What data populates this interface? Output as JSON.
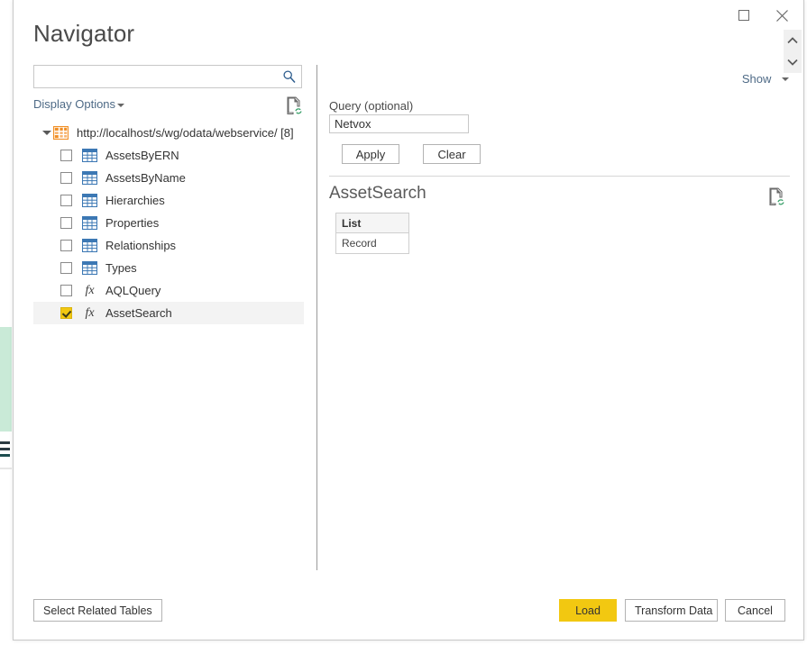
{
  "window": {
    "title": "Navigator",
    "maximize_icon": "maximize-icon",
    "close_icon": "close-icon"
  },
  "left_pane": {
    "search": {
      "value": "",
      "placeholder": "",
      "icon": "search-icon"
    },
    "display_options": {
      "label": "Display Options",
      "caret_icon": "chevron-down-icon"
    },
    "refresh_icon": "refresh-document-icon",
    "tree": {
      "root": {
        "label": "http://localhost/s/wg/odata/webservice/ [8]",
        "icon": "database-icon",
        "expander_icon": "expander-open-icon",
        "expanded": true
      },
      "items": [
        {
          "label": "AssetsByERN",
          "icon": "table-icon",
          "checked": false,
          "selected": false
        },
        {
          "label": "AssetsByName",
          "icon": "table-icon",
          "checked": false,
          "selected": false
        },
        {
          "label": "Hierarchies",
          "icon": "table-icon",
          "checked": false,
          "selected": false
        },
        {
          "label": "Properties",
          "icon": "table-icon",
          "checked": false,
          "selected": false
        },
        {
          "label": "Relationships",
          "icon": "table-icon",
          "checked": false,
          "selected": false
        },
        {
          "label": "Types",
          "icon": "table-icon",
          "checked": false,
          "selected": false
        },
        {
          "label": "AQLQuery",
          "icon": "function-icon",
          "checked": false,
          "selected": false
        },
        {
          "label": "AssetSearch",
          "icon": "function-icon",
          "checked": true,
          "selected": true
        }
      ]
    }
  },
  "right_pane": {
    "show": {
      "label": "Show",
      "caret_icon": "chevron-down-icon"
    },
    "query": {
      "label": "Query (optional)",
      "value": "Netvox",
      "placeholder": "",
      "apply_label": "Apply",
      "clear_label": "Clear"
    },
    "preview": {
      "title": "AssetSearch",
      "refresh_icon": "refresh-document-icon",
      "table": {
        "columns": [
          "List"
        ],
        "rows": [
          [
            "Record"
          ]
        ]
      }
    },
    "scroll": {
      "up_icon": "chevron-up-icon",
      "down_icon": "chevron-down-icon"
    }
  },
  "footer": {
    "select_related_label": "Select Related Tables",
    "load_label": "Load",
    "transform_label": "Transform Data",
    "cancel_label": "Cancel"
  },
  "colors": {
    "accent_yellow": "#f2c811",
    "link_blue": "#4e6a86",
    "table_icon_blue": "#3c78b4",
    "database_icon_orange": "#f18f26",
    "selection_gray": "#f3f3f3",
    "backdrop_green": "#c9ead7"
  }
}
